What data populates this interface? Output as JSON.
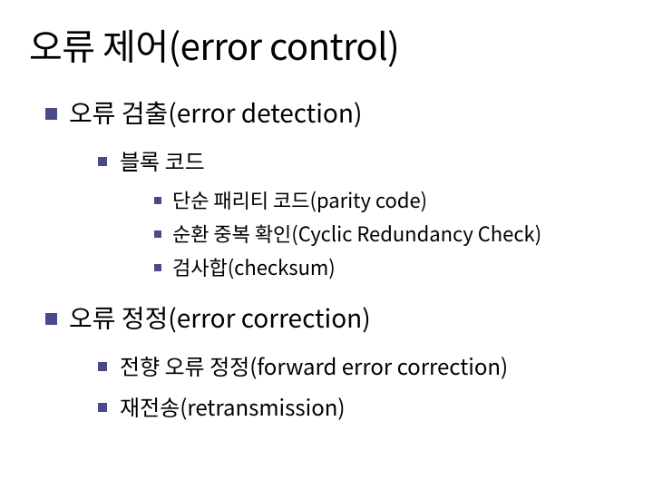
{
  "colors": {
    "bullet": "#4a4a8a",
    "text": "#000000",
    "background": "#ffffff"
  },
  "title": "오류 제어(error control)",
  "sections": [
    {
      "label": "오류 검출(error detection)",
      "children": [
        {
          "label": "블록 코드",
          "children": [
            {
              "label": "단순 패리티 코드(parity code)"
            },
            {
              "label": "순환 중복 확인(Cyclic Redundancy Check)"
            },
            {
              "label": "검사합(checksum)"
            }
          ]
        }
      ]
    },
    {
      "label": "오류 정정(error correction)",
      "children": [
        {
          "label": "전향 오류 정정(forward error correction)"
        },
        {
          "label": "재전송(retransmission)"
        }
      ]
    }
  ]
}
